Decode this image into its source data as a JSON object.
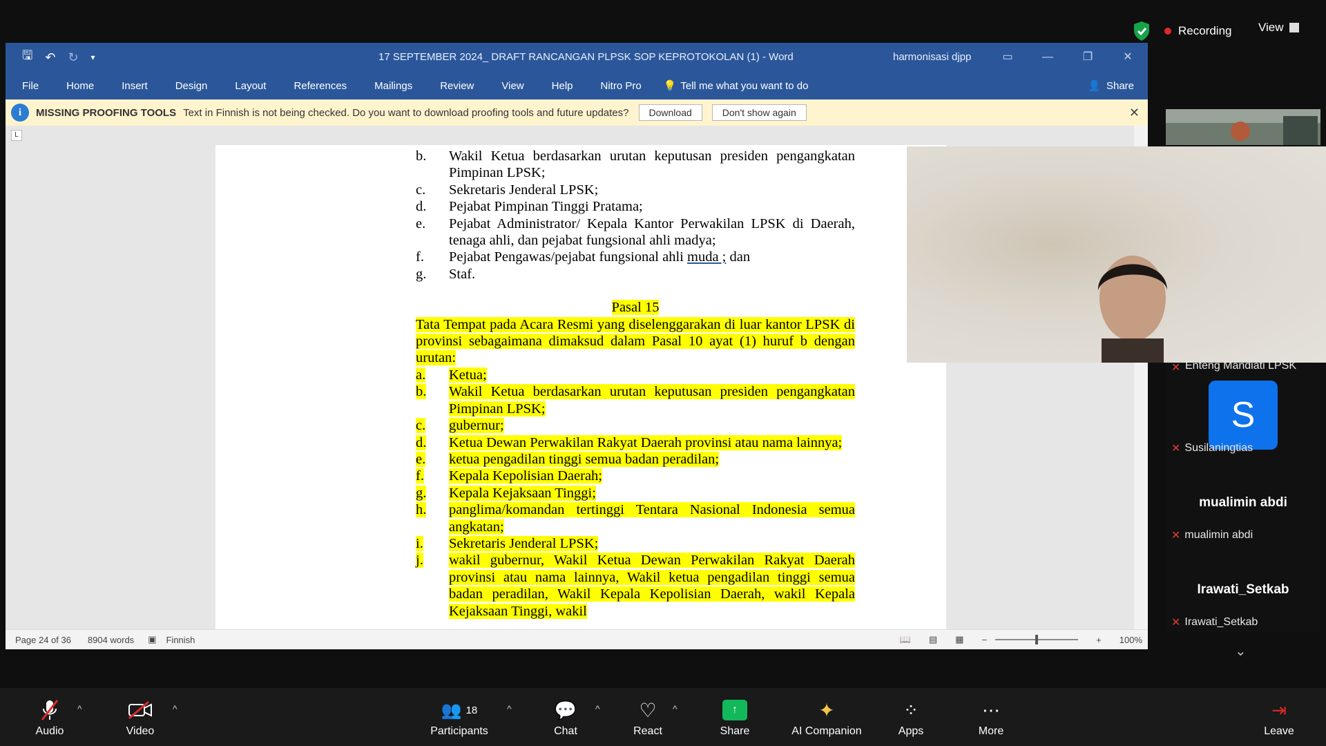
{
  "zoom_top": {
    "recording_label": "Recording",
    "view_label": "View"
  },
  "word": {
    "title": "17 SEPTEMBER 2024_ DRAFT RANCANGAN PLPSK SOP KEPROTOKOLAN (1)  -  Word",
    "user": "harmonisasi djpp",
    "tabs": [
      "File",
      "Home",
      "Insert",
      "Design",
      "Layout",
      "References",
      "Mailings",
      "Review",
      "View",
      "Help",
      "Nitro Pro"
    ],
    "tell_me": "Tell me what you want to do",
    "share": "Share",
    "msgbar": {
      "title": "MISSING PROOFING TOOLS",
      "text": "Text in Finnish is not being checked. Do you want to download proofing tools and future updates?",
      "download": "Download",
      "dont_show": "Don't show again"
    },
    "status": {
      "page": "Page 24 of 36",
      "words": "8904 words",
      "language": "Finnish",
      "zoom": "100%"
    },
    "doc": {
      "top_items": [
        {
          "label": "b.",
          "text": "Wakil Ketua berdasarkan urutan keputusan presiden pengangkatan Pimpinan LPSK;"
        },
        {
          "label": "c.",
          "text": "Sekretaris Jenderal LPSK;"
        },
        {
          "label": "d.",
          "text": "Pejabat Pimpinan Tinggi Pratama;"
        },
        {
          "label": "e.",
          "text": "Pejabat Administrator/ Kepala Kantor Perwakilan LPSK di Daerah, tenaga ahli, dan pejabat fungsional ahli madya;"
        },
        {
          "label": "f.",
          "text_pre": "Pejabat Pengawas/pejabat fungsional ahli ",
          "text_ul": "muda ;",
          "text_post": " dan"
        },
        {
          "label": "g.",
          "text": "Staf."
        }
      ],
      "pasal_title": "Pasal 15",
      "pasal_intro": "Tata Tempat pada Acara Resmi yang diselenggarakan di luar kantor LPSK di provinsi sebagaimana dimaksud dalam Pasal 10 ayat (1) huruf b dengan urutan:",
      "items": [
        {
          "label": "a.",
          "text": "Ketua;"
        },
        {
          "label": "b.",
          "text": "Wakil Ketua berdasarkan urutan keputusan presiden pengangkatan Pimpinan LPSK;"
        },
        {
          "label": "c.",
          "text": "gubernur;"
        },
        {
          "label": "d.",
          "text": "Ketua Dewan Perwakilan Rakyat Daerah provinsi atau nama lainnya;"
        },
        {
          "label": "e.",
          "text": "ketua pengadilan tinggi semua badan peradilan;"
        },
        {
          "label": "f.",
          "text": "Kepala Kepolisian Daerah;"
        },
        {
          "label": "g.",
          "text": "Kepala Kejaksaan Tinggi;"
        },
        {
          "label": "h.",
          "text": "panglima/komandan tertinggi Tentara Nasional Indonesia semua angkatan;"
        },
        {
          "label": "i.",
          "text": "Sekretaris Jenderal LPSK;"
        },
        {
          "label": "j.",
          "text": "wakil gubernur, Wakil Ketua Dewan Perwakilan Rakyat Daerah provinsi atau nama lainnya, Wakil ketua pengadilan tinggi semua badan peradilan, Wakil Kepala Kepolisian Daerah, wakil Kepala Kejaksaan Tinggi, wakil"
        }
      ]
    }
  },
  "participants": {
    "partial_name": "Enteng Mandiati LPSK",
    "s_avatar_letter": "S",
    "s_name": "Susilaningtias",
    "p2_display": "mualimin abdi",
    "p2_name": "mualimin abdi",
    "p3_display": "Irawati_Setkab",
    "p3_name": "Irawati_Setkab"
  },
  "toolbar": {
    "audio": "Audio",
    "video": "Video",
    "participants": "Participants",
    "participant_count": "18",
    "chat": "Chat",
    "react": "React",
    "share": "Share",
    "ai": "AI Companion",
    "apps": "Apps",
    "more": "More",
    "leave": "Leave"
  },
  "colors": {
    "word_blue": "#2b579a",
    "highlight": "#ffff00",
    "share_green": "#12b85a",
    "zoom_blue": "#0e72ed"
  }
}
